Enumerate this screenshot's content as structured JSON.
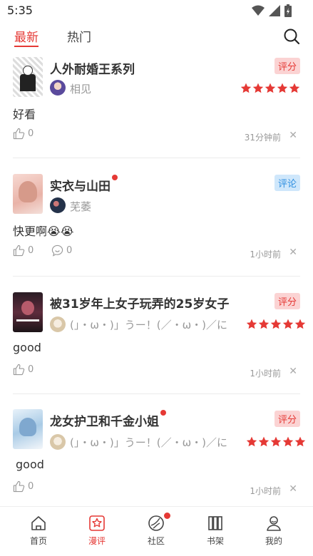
{
  "status": {
    "time": "5:35"
  },
  "tabs": {
    "latest": "最新",
    "hot": "热门"
  },
  "posts": [
    {
      "title": "人外耐婚王系列",
      "tag": "评分",
      "user": "相见",
      "body": "好看",
      "likes": "0",
      "time": "31分钟前",
      "stars": 5
    },
    {
      "title": "实衣与山田",
      "tag": "评论",
      "user": "芜萎",
      "body": "快更啊😭😭",
      "likes": "0",
      "comments": "0",
      "time": "1小时前"
    },
    {
      "title": "被31岁年上女子玩弄的25岁女子",
      "tag": "评分",
      "user": "(」・ω・)」うー！(／・ω・)／に",
      "body": "good",
      "likes": "0",
      "time": "1小时前",
      "stars": 5
    },
    {
      "title": "龙女护卫和千金小姐",
      "tag": "评分",
      "user": "(」・ω・)」うー！(／・ω・)／に",
      "body": "good",
      "likes": "0",
      "time": "1小时前",
      "stars": 5
    }
  ],
  "nav": {
    "home": "首页",
    "review": "漫评",
    "community": "社区",
    "shelf": "书架",
    "mine": "我的"
  },
  "colors": {
    "accent": "#e53935",
    "comment_tag": "#2f8fe0"
  }
}
